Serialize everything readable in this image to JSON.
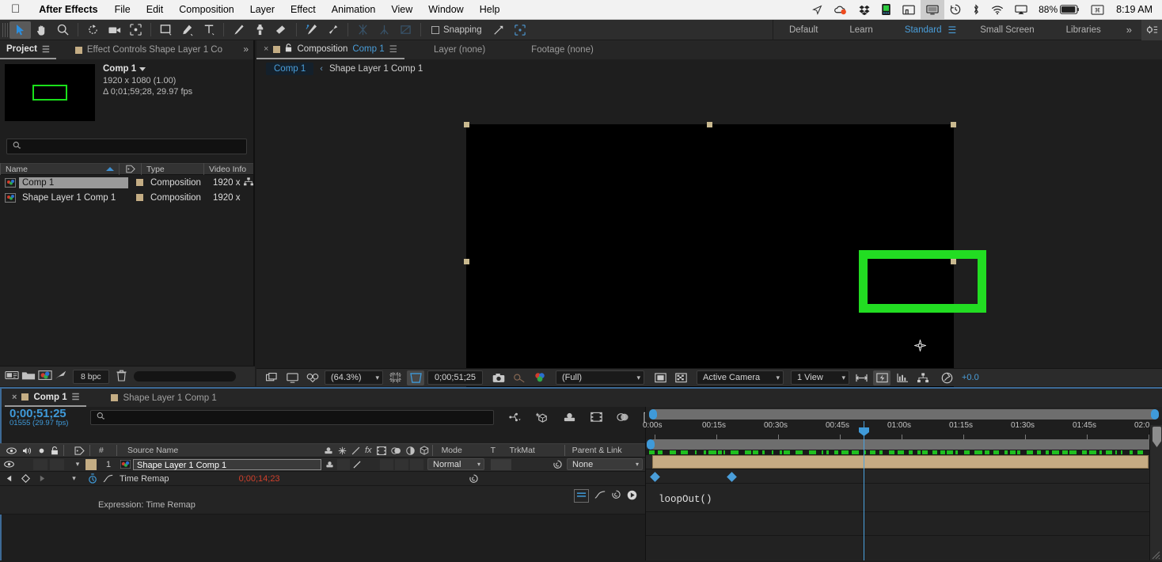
{
  "macbar": {
    "apple_icon": "apple-logo",
    "app_name": "After Effects",
    "menus": [
      "File",
      "Edit",
      "Composition",
      "Layer",
      "Effect",
      "Animation",
      "View",
      "Window",
      "Help"
    ],
    "status_icons": [
      "location-arrow-icon",
      "cloud-sync-icon",
      "dropbox-icon",
      "drive-icon",
      "airplay-display-icon",
      "monitor-icon",
      "time-machine-icon",
      "bluetooth-icon",
      "wifi-icon",
      "screen-mirror-icon"
    ],
    "battery_pct": "88%",
    "battery_icon": "battery-icon",
    "input_source_icon": "keyboard-input-icon",
    "clock": "8:19 AM"
  },
  "toolbar": {
    "tools": [
      {
        "name": "selection-tool",
        "selected": true
      },
      {
        "name": "hand-tool",
        "selected": false
      },
      {
        "name": "zoom-tool",
        "selected": false
      },
      {
        "name": "rotation-tool",
        "selected": false
      },
      {
        "name": "camera-tool",
        "selected": false
      },
      {
        "name": "anchor-point-tool",
        "selected": false
      },
      {
        "name": "shape-tool",
        "selected": false
      },
      {
        "name": "pen-tool",
        "selected": false
      },
      {
        "name": "type-tool",
        "selected": false
      },
      {
        "name": "brush-tool",
        "selected": false
      },
      {
        "name": "clone-stamp-tool",
        "selected": false
      },
      {
        "name": "eraser-tool",
        "selected": false
      },
      {
        "name": "roto-brush-tool",
        "selected": false
      },
      {
        "name": "puppet-pin-tool",
        "selected": false
      }
    ],
    "dimmed_tools": [
      "puppet-starch-tool",
      "puppet-overlap-tool",
      "puppet-bend-tool"
    ],
    "snapping_label": "Snapping",
    "snapping_checked": false,
    "workspaces": [
      {
        "label": "Default",
        "active": false
      },
      {
        "label": "Learn",
        "active": false
      },
      {
        "label": "Standard",
        "active": true
      },
      {
        "label": "Small Screen",
        "active": false
      },
      {
        "label": "Libraries",
        "active": false
      }
    ],
    "overflow_icon": "double-chevron-right-icon",
    "workspace_gear_icon": "workspace-settings-icon"
  },
  "project_panel": {
    "tabs": [
      {
        "label": "Project",
        "active": true,
        "icon": "hamburger-menu-icon"
      },
      {
        "label": "Effect Controls Shape Layer 1 Co",
        "active": false,
        "swatch": "#c4ad84"
      }
    ],
    "overflow_icon": "double-chevron-right-icon",
    "thumbnail_name": "comp-thumbnail",
    "info": {
      "name": "Comp 1",
      "dimensions": "1920 x 1080 (1.00)",
      "duration": "Δ 0;01;59;28, 29.97 fps"
    },
    "search_placeholder": "",
    "search_icon": "search-icon",
    "columns": [
      "Name",
      "Type",
      "Video Info"
    ],
    "sort_indicator": "ascending",
    "items": [
      {
        "name": "Comp 1",
        "type": "Composition",
        "video_info": "1920 x",
        "selected": true,
        "has_link_icon": true
      },
      {
        "name": "Shape Layer 1 Comp 1",
        "type": "Composition",
        "video_info": "1920 x",
        "selected": false,
        "has_link_icon": false
      }
    ],
    "footer": {
      "icons": [
        "interpret-footage-icon",
        "new-folder-icon",
        "new-composition-icon",
        "project-settings-icon",
        "delete-icon"
      ],
      "bit_depth": "8 bpc"
    }
  },
  "composition_panel": {
    "tabs": [
      {
        "label_prefix": "Composition",
        "label_comp": "Comp 1",
        "active": true,
        "close_icon": "close-icon",
        "swatch": "#c4ad84",
        "lock_icon": "lock-icon",
        "menu_icon": "hamburger-menu-icon"
      },
      {
        "label": "Layer (none)",
        "active": false
      },
      {
        "label": "Footage (none)",
        "active": false
      }
    ],
    "breadcrumb": {
      "current": "Comp 1",
      "separator_icon": "chevron-left-icon",
      "child": "Shape Layer 1 Comp 1"
    },
    "canvas": {
      "background": "#000000",
      "shape_color": "#22dd22",
      "anchor_icon": "anchor-point-icon",
      "selection_handles": 8
    },
    "viewer_toolbar": {
      "always_preview_icon": "always-preview-this-view-icon",
      "main_view_icon": "main-viewer-icon",
      "render_icon": "3d-renderer-icon",
      "zoom_level": "(64.3%)",
      "grid_icon": "grid-and-guides-icon",
      "region_icon": "region-of-interest-icon",
      "timecode": "0;00;51;25",
      "snapshot_icon": "take-snapshot-icon",
      "show_snapshot_icon": "show-snapshot-icon",
      "channels_icon": "show-channel-icon",
      "resolution": "(Full)",
      "mask_icon": "toggle-mask-icon",
      "transparency_icon": "toggle-transparency-grid-icon",
      "camera": "Active Camera",
      "views": "1 View",
      "pixel_aspect_icon": "pixel-aspect-correction-icon",
      "fast_preview_icon": "fast-previews-icon",
      "timeline_icon": "timeline-icon",
      "comp_flowchart_icon": "comp-flowchart-icon",
      "exposure_icon": "reset-exposure-icon",
      "exposure_value": "+0.0"
    }
  },
  "timeline_panel": {
    "tabs": [
      {
        "label": "Comp 1",
        "active": true,
        "close_icon": "close-icon",
        "swatch": "#c4ad84",
        "menu_icon": "hamburger-menu-icon"
      },
      {
        "label": "Shape Layer 1 Comp 1",
        "active": false,
        "swatch": "#c4ad84"
      }
    ],
    "current_time": "0;00;51;25",
    "current_frame": "01555 (29.97 fps)",
    "search_placeholder": "",
    "search_icon": "search-icon",
    "toolbar_icons": [
      "composition-mini-flowchart-icon",
      "draft-3d-icon",
      "hide-shy-layers-icon",
      "frame-blending-icon",
      "motion-blur-icon",
      "graph-editor-icon"
    ],
    "columns": {
      "av_features": [
        "video-icon",
        "audio-icon",
        "solo-icon",
        "lock-icon"
      ],
      "label": "label-icon",
      "number": "#",
      "source_name": "Source Name",
      "switches": [
        "shy-icon",
        "collapse-transformations-icon",
        "quality-icon",
        "effects-icon",
        "frame-blend-icon",
        "motion-blur-icon",
        "adjustment-layer-icon",
        "3d-layer-icon"
      ],
      "mode": "Mode",
      "t": "T",
      "trkmat": "TrkMat",
      "parent_link": "Parent & Link"
    },
    "layers": [
      {
        "index": "1",
        "name": "Shape Layer 1 Comp 1",
        "visible": true,
        "mode": "Normal",
        "parent": "None",
        "label_color": "#c4ad84",
        "bar_color": "#c5ab83"
      }
    ],
    "properties": [
      {
        "name": "Time Remap",
        "value": "0;00;14;23",
        "stopwatch_icon": "stopwatch-enabled-icon",
        "graph_icon": "graph-editor-set-icon",
        "expression_icon": "expression-pickwhip-icon"
      }
    ],
    "expression": {
      "label": "Expression: Time Remap",
      "code": "loopOut()",
      "tools": [
        "expression-enabled-icon",
        "expression-graph-icon",
        "expression-pickwhip-icon",
        "expression-language-menu-icon"
      ]
    },
    "ruler": {
      "ticks": [
        "0:00s",
        "00:15s",
        "00:30s",
        "00:45s",
        "01:00s",
        "01:15s",
        "01:30s",
        "01:45s",
        "02:0"
      ],
      "playhead_time": "0;00;51;25"
    },
    "keyframes_count": 2
  }
}
